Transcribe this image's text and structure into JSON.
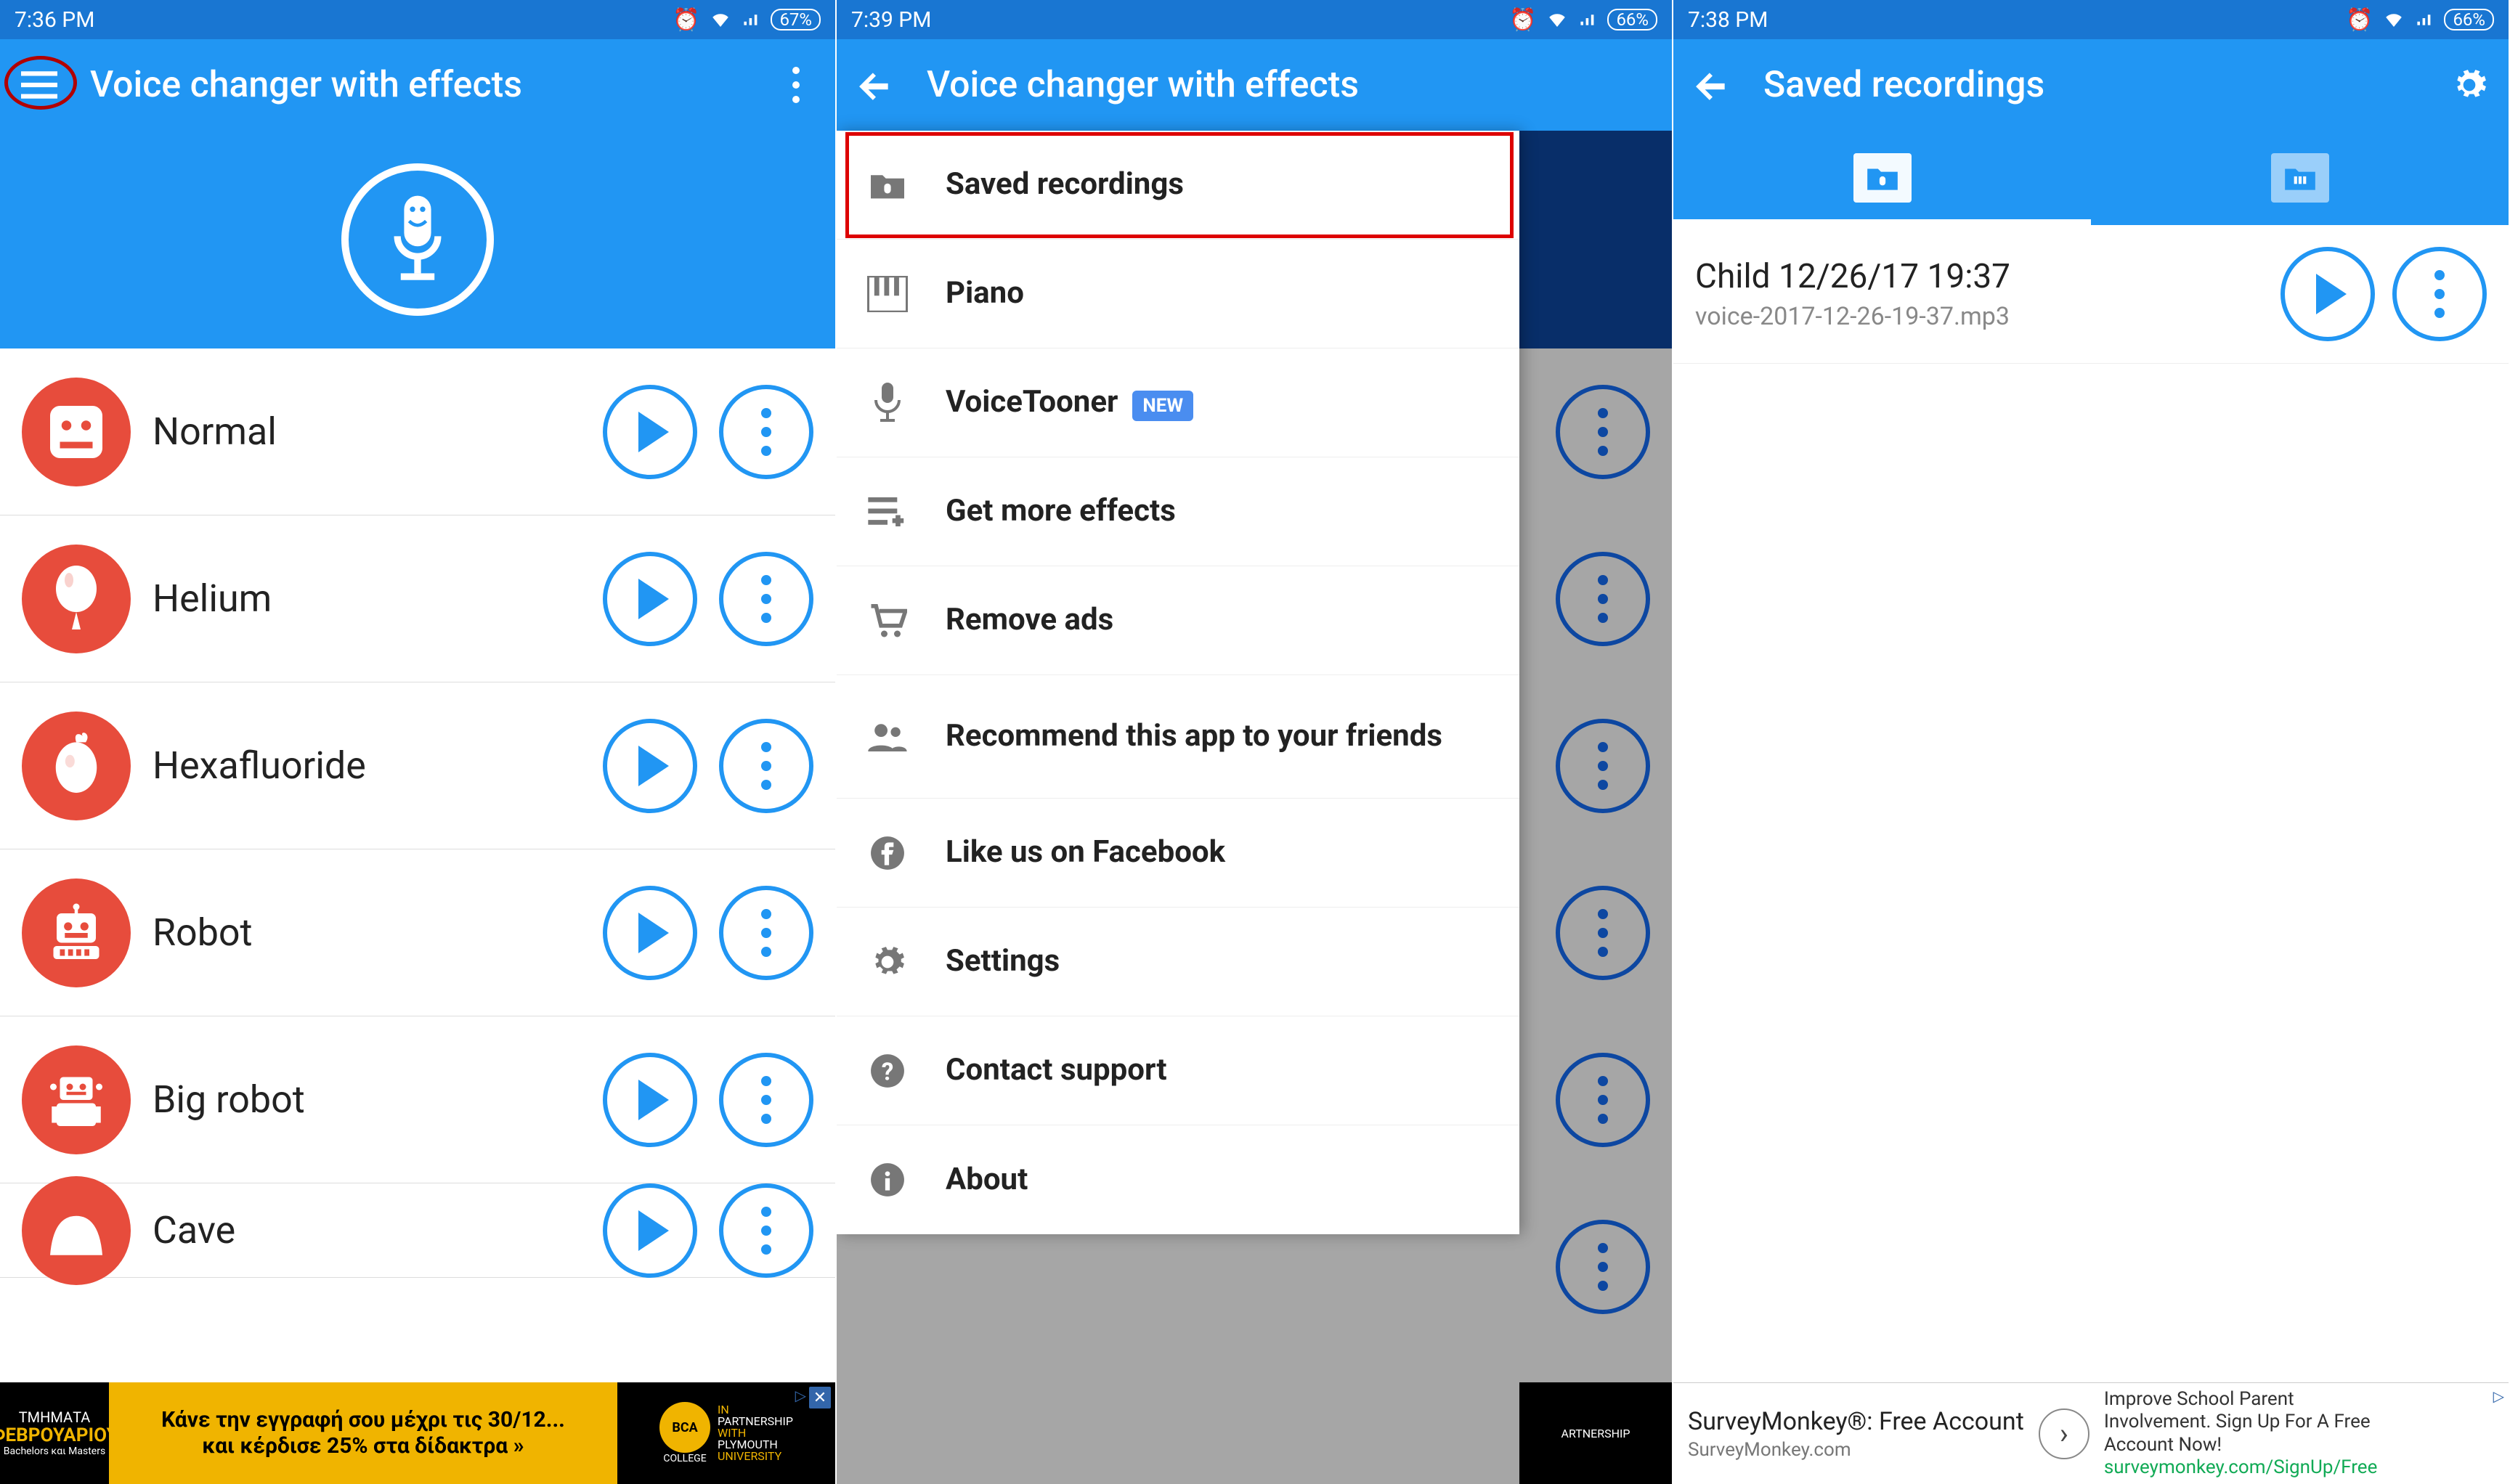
{
  "screen1": {
    "status": {
      "time": "7:36 PM",
      "battery": "67%"
    },
    "app_title": "Voice changer with effects",
    "effects": [
      {
        "name": "Normal",
        "icon": "face"
      },
      {
        "name": "Helium",
        "icon": "balloon"
      },
      {
        "name": "Hexafluoride",
        "icon": "molecule"
      },
      {
        "name": "Robot",
        "icon": "robot"
      },
      {
        "name": "Big robot",
        "icon": "bigrobot"
      },
      {
        "name": "Cave",
        "icon": "cave"
      }
    ],
    "ad": {
      "left_line1": "ΤΜΗΜΑΤΑ",
      "left_line2": "ΦΕΒΡΟΥΑΡΙΟΥ",
      "left_line3": "Bachelors και Masters",
      "mid_line1": "Κάνε την εγγραφή σου μέχρι τις 30/12...",
      "mid_line2": "και κέρδισε 25% στα δίδακτρα »",
      "right_college": "BCA",
      "right_college2": "COLLEGE",
      "right_partner1": "IN",
      "right_partner2": "PARTNERSHIP",
      "right_partner3": "WITH",
      "right_partner4": "PLYMOUTH",
      "right_partner5": "UNIVERSITY"
    }
  },
  "screen2": {
    "status": {
      "time": "7:39 PM",
      "battery": "66%"
    },
    "app_title": "Voice changer with effects",
    "drawer": [
      {
        "label": "Saved recordings",
        "icon": "folder-mic"
      },
      {
        "label": "Piano",
        "icon": "piano"
      },
      {
        "label": "VoiceTooner",
        "icon": "mic",
        "badge": "NEW"
      },
      {
        "label": "Get more effects",
        "icon": "list-plus"
      },
      {
        "label": "Remove ads",
        "icon": "cart"
      },
      {
        "label": "Recommend this app to your friends",
        "icon": "people"
      },
      {
        "label": "Like us on Facebook",
        "icon": "facebook"
      },
      {
        "label": "Settings",
        "icon": "gear"
      },
      {
        "label": "Contact support",
        "icon": "help"
      },
      {
        "label": "About",
        "icon": "info"
      }
    ],
    "ad_partial": "ARTNERSHIP"
  },
  "screen3": {
    "status": {
      "time": "7:38 PM",
      "battery": "66%"
    },
    "app_title": "Saved recordings",
    "recording": {
      "title": "Child 12/26/17 19:37",
      "file": "voice-2017-12-26-19-37.mp3"
    },
    "ad": {
      "title": "SurveyMonkey®: Free Account",
      "url": "SurveyMonkey.com",
      "desc1": "Improve School Parent",
      "desc2": "Involvement. Sign Up For A Free",
      "desc3": "Account Now!",
      "desc4": "surveymonkey.com/SignUp/Free"
    }
  }
}
